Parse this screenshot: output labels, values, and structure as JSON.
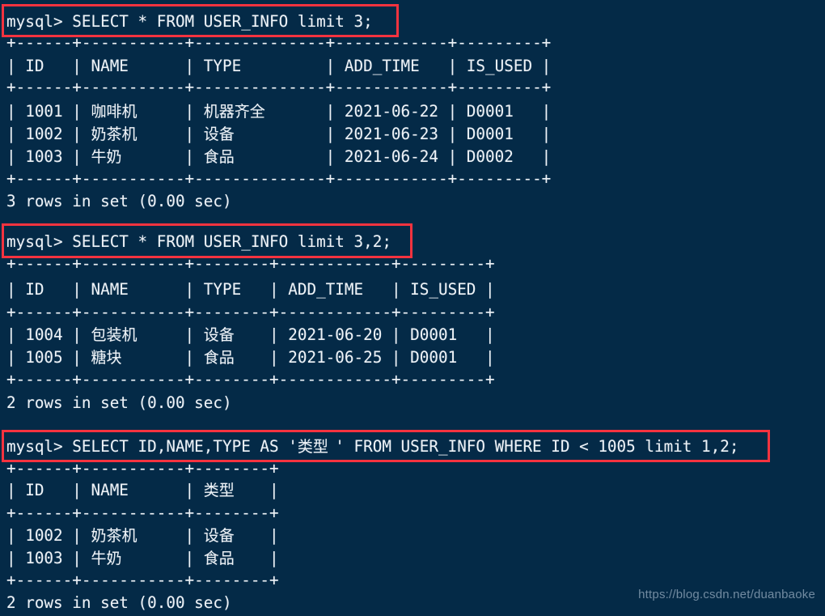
{
  "terminal": {
    "prompt": "mysql> ",
    "background_color": "#042A47",
    "text_color": "#EDF2F7",
    "highlight_color": "#F5333F",
    "watermark": "https://blog.csdn.net/duanbaoke"
  },
  "blocks": [
    {
      "id": "block-1",
      "command": "mysql> SELECT * FROM USER_INFO limit 3;",
      "highlighted": true,
      "separator": "+------+-----------+--------------+------------+---------+",
      "header": "| ID   | NAME      | TYPE         | ADD_TIME   | IS_USED |",
      "rows": [
        "| 1001 | 咖啡机    | 机器齐全     | 2021-06-22 | D0001   |",
        "| 1002 | 奶茶机    | 设备         | 2021-06-23 | D0001   |",
        "| 1003 | 牛奶      | 食品         | 2021-06-24 | D0002   |"
      ],
      "footer": "3 rows in set (0.00 sec)",
      "columns": [
        "ID",
        "NAME",
        "TYPE",
        "ADD_TIME",
        "IS_USED"
      ],
      "data": [
        {
          "ID": "1001",
          "NAME": "咖啡机",
          "TYPE": "机器齐全",
          "ADD_TIME": "2021-06-22",
          "IS_USED": "D0001"
        },
        {
          "ID": "1002",
          "NAME": "奶茶机",
          "TYPE": "设备",
          "ADD_TIME": "2021-06-23",
          "IS_USED": "D0001"
        },
        {
          "ID": "1003",
          "NAME": "牛奶",
          "TYPE": "食品",
          "ADD_TIME": "2021-06-24",
          "IS_USED": "D0002"
        }
      ]
    },
    {
      "id": "block-2",
      "command": "mysql> SELECT * FROM USER_INFO limit 3,2;",
      "highlighted": true,
      "separator": "+------+-----------+--------+------------+---------+",
      "header": "| ID   | NAME      | TYPE   | ADD_TIME   | IS_USED |",
      "rows": [
        "| 1004 | 包装机    | 设备   | 2021-06-20 | D0001   |",
        "| 1005 | 糖块      | 食品   | 2021-06-25 | D0001   |"
      ],
      "footer": "2 rows in set (0.00 sec)",
      "columns": [
        "ID",
        "NAME",
        "TYPE",
        "ADD_TIME",
        "IS_USED"
      ],
      "data": [
        {
          "ID": "1004",
          "NAME": "包装机",
          "TYPE": "设备",
          "ADD_TIME": "2021-06-20",
          "IS_USED": "D0001"
        },
        {
          "ID": "1005",
          "NAME": "糖块",
          "TYPE": "食品",
          "ADD_TIME": "2021-06-25",
          "IS_USED": "D0001"
        }
      ]
    },
    {
      "id": "block-3",
      "command": "mysql> SELECT ID,NAME,TYPE AS '类型' FROM USER_INFO WHERE ID < 1005 limit 1,2;",
      "highlighted": true,
      "separator": "+------+-----------+--------+",
      "header": "| ID   | NAME      | 类型   |",
      "rows": [
        "| 1002 | 奶茶机    | 设备   |",
        "| 1003 | 牛奶      | 食品   |"
      ],
      "footer": "2 rows in set (0.00 sec)",
      "columns": [
        "ID",
        "NAME",
        "类型"
      ],
      "data": [
        {
          "ID": "1002",
          "NAME": "奶茶机",
          "类型": "设备"
        },
        {
          "ID": "1003",
          "NAME": "牛奶",
          "类型": "食品"
        }
      ]
    }
  ]
}
